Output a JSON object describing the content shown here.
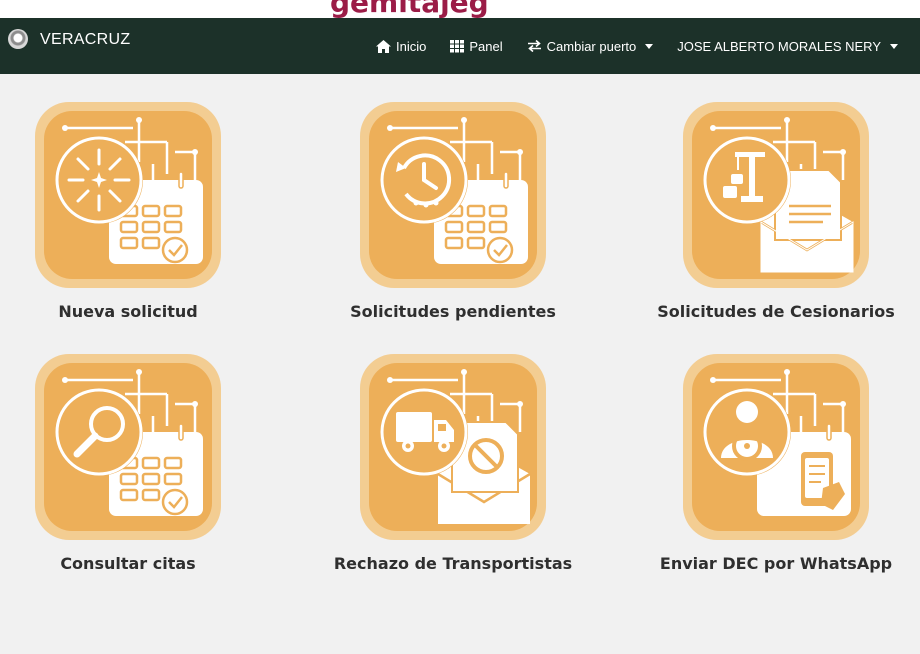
{
  "banner": {
    "title_fragment": "gemitajeg"
  },
  "navbar": {
    "brand": "VERACRUZ",
    "home_label": "Inicio",
    "panel_label": "Panel",
    "port_label": "Cambiar puerto",
    "user_label": "JOSE ALBERTO MORALES NERY"
  },
  "tiles": [
    {
      "label": "Nueva solicitud",
      "icon": "new-request-icon"
    },
    {
      "label": "Solicitudes pendientes",
      "icon": "pending-requests-icon"
    },
    {
      "label": "Solicitudes de Cesionarios",
      "icon": "assignee-requests-icon"
    },
    {
      "label": "Consultar citas",
      "icon": "search-appointments-icon"
    },
    {
      "label": "Rechazo de Transportistas",
      "icon": "carrier-rejection-icon"
    },
    {
      "label": "Enviar DEC por WhatsApp",
      "icon": "send-dec-whatsapp-icon"
    }
  ],
  "colors": {
    "navbar": "#1c3129",
    "tile_outer": "#f3cd92",
    "tile_inner": "#edaf59",
    "page_bg": "#f1f1f1"
  }
}
